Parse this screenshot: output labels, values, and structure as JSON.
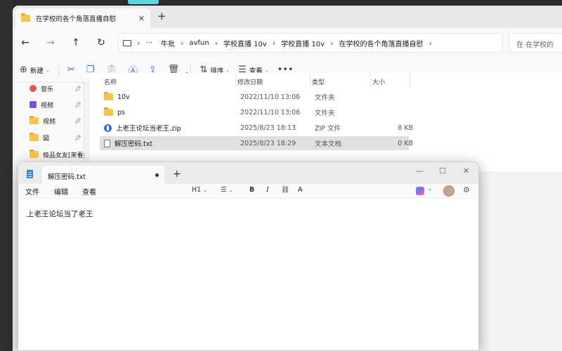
{
  "explorer": {
    "tab_title": "在学校的各个角落直播自慰",
    "tab_close": "✕",
    "tab_add": "+",
    "nav": {
      "back": "←",
      "forward": "→",
      "up": "↑",
      "refresh": "↻"
    },
    "breadcrumbs": [
      "牛批",
      "avfun",
      "学校直播 10v",
      "学校直播 10v",
      "在学校的各个角落直播自慰"
    ],
    "breadcrumb_more": "···",
    "search_placeholder": "在 在学校的",
    "toolbar": {
      "new_label": "新建",
      "sort_label": "排序",
      "view_label": "查看",
      "more": "•••"
    },
    "sidebar": [
      {
        "label": "音乐",
        "icon": "music-icon"
      },
      {
        "label": "视频",
        "icon": "video-icon"
      },
      {
        "label": "视频",
        "icon": "folder-icon"
      },
      {
        "label": "図",
        "icon": "folder-icon"
      },
      {
        "label": "极品女友[来看美",
        "icon": "folder-icon"
      }
    ],
    "columns": {
      "name": "名称",
      "modified": "修改日期",
      "type": "类型",
      "size": "大小"
    },
    "files": [
      {
        "name": "10v",
        "modified": "2022/11/10 13:06",
        "type": "文件夹",
        "size": "",
        "icon": "folder-icon"
      },
      {
        "name": "ps",
        "modified": "2022/11/10 13:06",
        "type": "文件夹",
        "size": "",
        "icon": "folder-icon"
      },
      {
        "name": "上老王论坛当老王.zip",
        "modified": "2025/8/23 18:13",
        "type": "ZIP 文件",
        "size": "8 KB",
        "icon": "zip-icon"
      },
      {
        "name": "解压密码.txt",
        "modified": "2025/8/23 18:29",
        "type": "文本文档",
        "size": "0 KB",
        "icon": "txt-icon",
        "selected": true
      }
    ]
  },
  "notepad": {
    "tab_title": "解压密码.txt",
    "tab_add": "+",
    "window_controls": {
      "minimize": "—",
      "maximize": "☐",
      "close": "✕"
    },
    "menu": {
      "file": "文件",
      "edit": "编辑",
      "view": "查看"
    },
    "format": {
      "heading": "H1",
      "bold": "B",
      "italic": "I"
    },
    "content": "上老王论坛当了老王"
  },
  "colors": {
    "accent": "#2f6fd6",
    "folder": "#f4c451",
    "selected_row": "#e0e0e0",
    "desktop_accent": "#5fd4e0"
  }
}
